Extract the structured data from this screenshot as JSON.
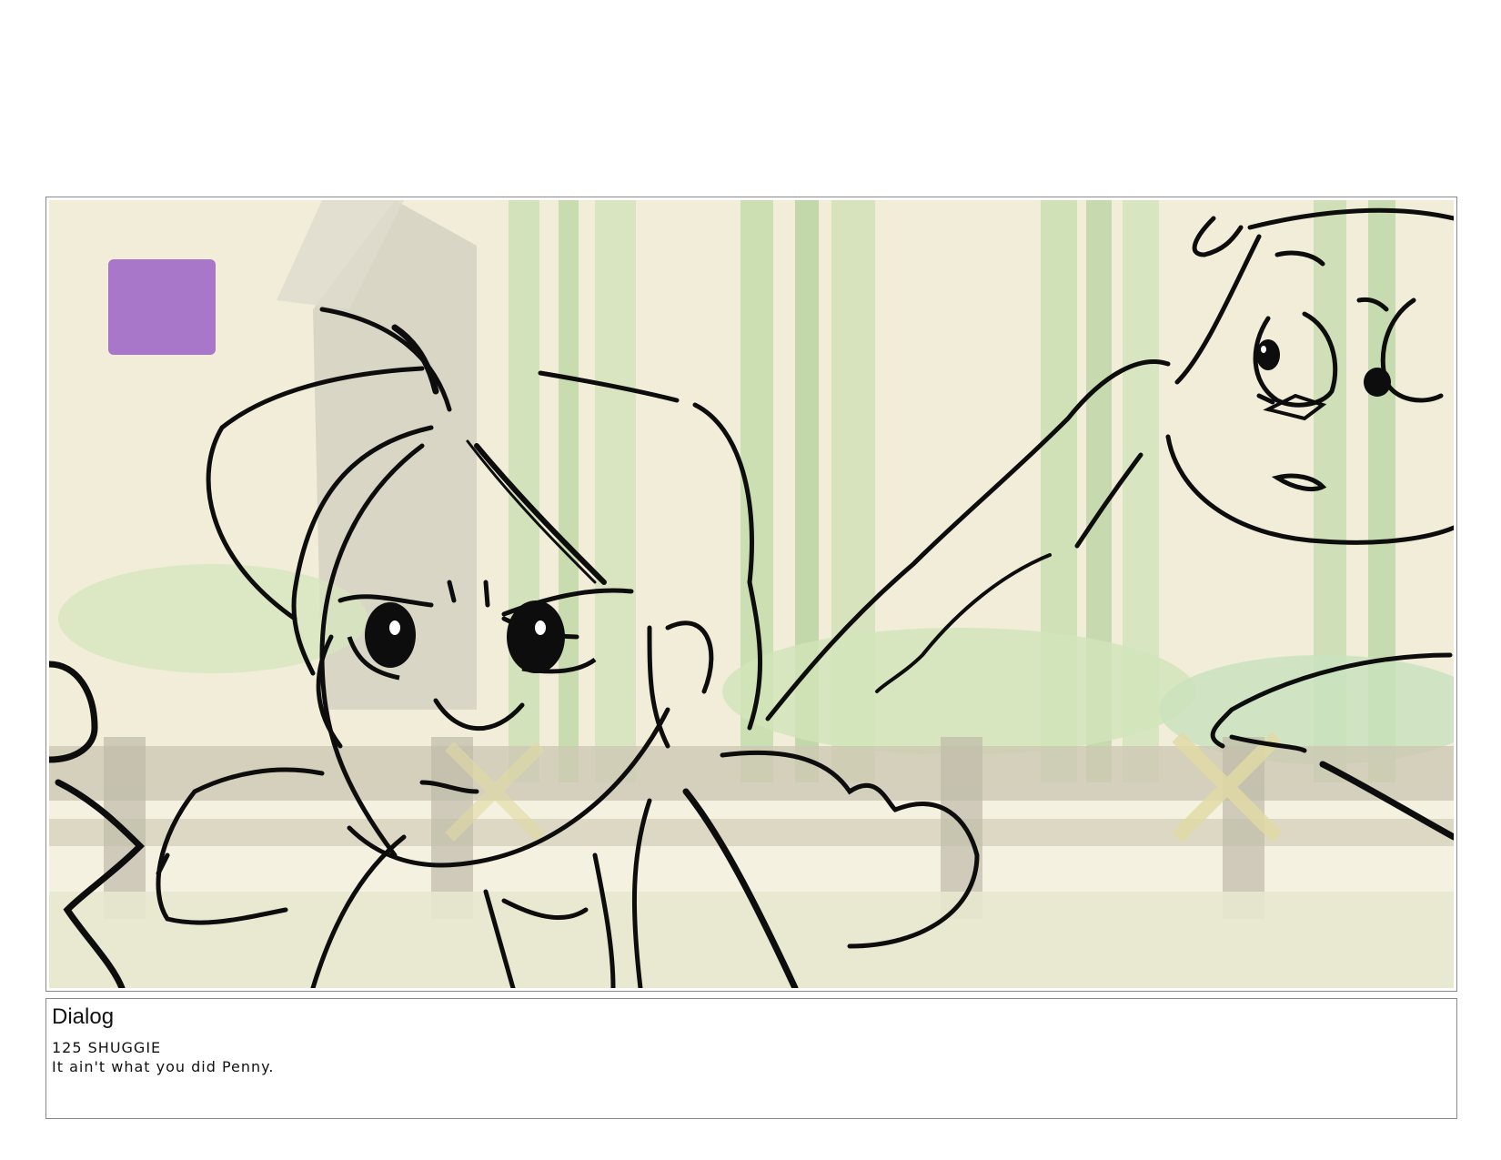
{
  "panel": {
    "marker_color": "#a877c9",
    "background_palette": {
      "sky": "#f1ecd6",
      "bamboo": "#b9d49a",
      "bamboo_dark": "#9fc283",
      "stone": "#c2bdab",
      "fence": "#b8b296",
      "ground": "#e3e2c0"
    },
    "sketch_color": "#0d0d0d"
  },
  "dialog": {
    "heading": "Dialog",
    "line1": "125 SHUGGIE",
    "line2": "It ain't what you did Penny."
  }
}
